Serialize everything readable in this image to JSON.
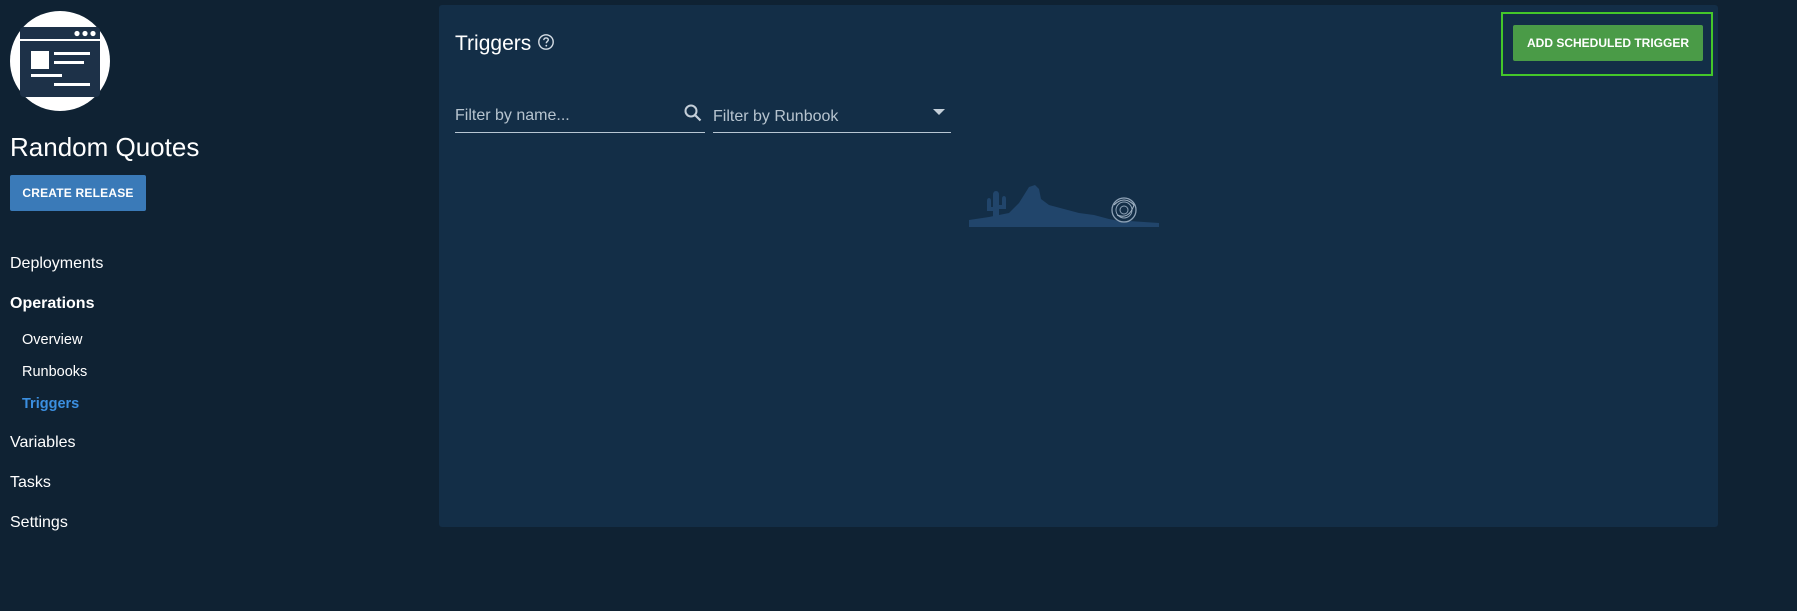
{
  "sidebar": {
    "project_name": "Random Quotes",
    "create_release_label": "CREATE RELEASE",
    "logo_icon": "project-browser-icon",
    "nav": {
      "deployments": "Deployments",
      "operations": "Operations",
      "overview": "Overview",
      "runbooks": "Runbooks",
      "triggers": "Triggers",
      "variables": "Variables",
      "tasks": "Tasks",
      "settings": "Settings"
    },
    "active_item": "Triggers"
  },
  "main": {
    "title": "Triggers",
    "add_trigger_label": "ADD SCHEDULED TRIGGER",
    "filter_name_placeholder": "Filter by name...",
    "filter_runbook_placeholder": "Filter by Runbook"
  },
  "colors": {
    "page_bg": "#0f2233",
    "panel_bg": "#132e47",
    "primary_button": "#3a7ab8",
    "success_button": "#4a9b47",
    "highlight_outline": "#44c72a",
    "active_nav": "#3b8fe0"
  }
}
